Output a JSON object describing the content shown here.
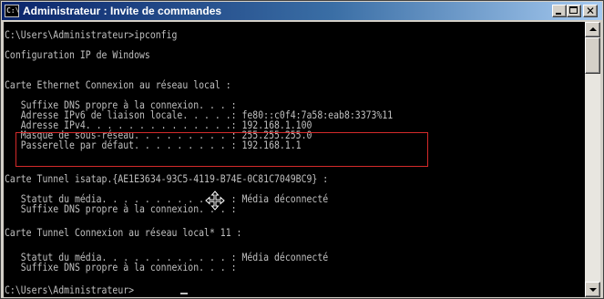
{
  "window": {
    "title": "Administrateur : Invite de commandes",
    "icon_label": "C:\\",
    "controls": {
      "minimize": "minimize-icon",
      "maximize": "maximize-icon",
      "close": "✕"
    }
  },
  "console": {
    "lines": [
      "C:\\Users\\Administrateur>ipconfig",
      "",
      "Configuration IP de Windows",
      "",
      "",
      "Carte Ethernet Connexion au réseau local :",
      "",
      "   Suffixe DNS propre à la connexion. . . :",
      "   Adresse IPv6 de liaison locale. . . . .: fe80::c0f4:7a58:eab8:3373%11",
      "   Adresse IPv4. . . . . . . . . . . . . .: 192.168.1.100",
      "   Masque de sous-réseau. . . . . . . . . : 255.255.255.0",
      "   Passerelle par défaut. . . . . . . . . : 192.168.1.1",
      "",
      "Carte Tunnel isatap.{AE1E3634-93C5-4119-B74E-0C81C7049BC9} :",
      "",
      "   Statut du média. . . . . . . . . . . . : Média déconnecté",
      "   Suffixe DNS propre à la connexion. . . :",
      "",
      "Carte Tunnel Connexion au réseau local* 11 :",
      "",
      "   Statut du média. . . . . . . . . . . . : Média déconnecté",
      "   Suffixe DNS propre à la connexion. . . :",
      "",
      "C:\\Users\\Administrateur>"
    ],
    "text_color": "#c0c0c0",
    "background": "#000000",
    "highlight_color": "#d42a2a"
  },
  "overlay": {
    "mouse_cursor": "move-cursor-icon"
  },
  "scrollbar": {
    "up": "scroll-up-arrow-icon",
    "down": "scroll-down-arrow-icon"
  }
}
